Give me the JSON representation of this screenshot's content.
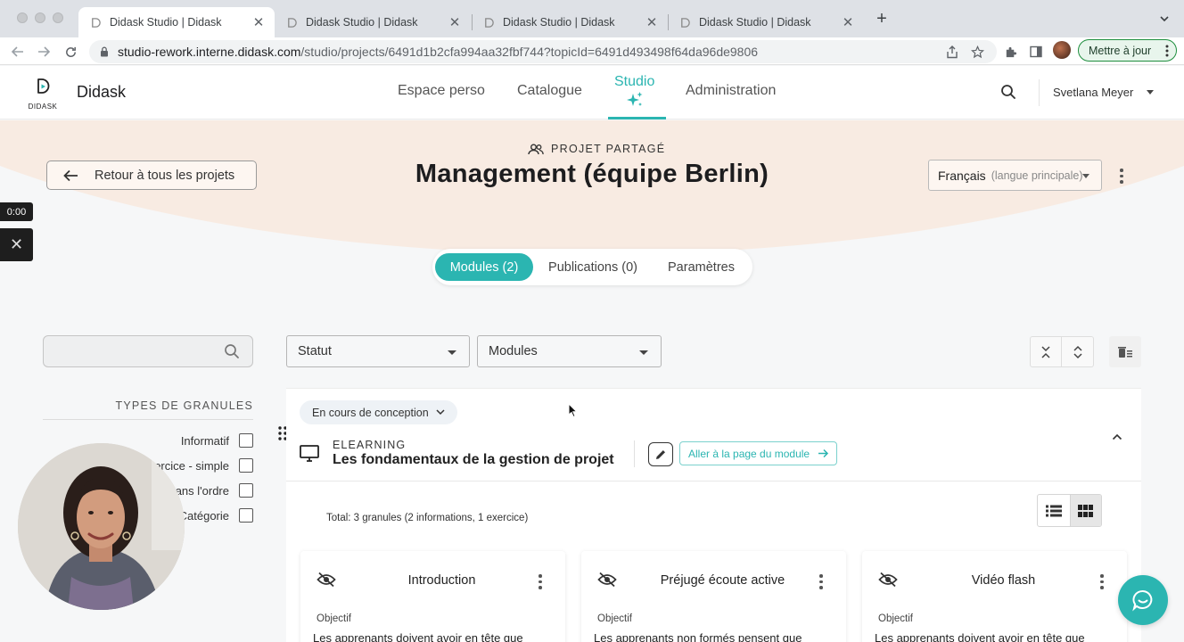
{
  "browser": {
    "tabs": [
      {
        "title": "Didask Studio | Didask",
        "active": true
      },
      {
        "title": "Didask Studio | Didask",
        "active": false
      },
      {
        "title": "Didask Studio | Didask",
        "active": false
      },
      {
        "title": "Didask Studio | Didask",
        "active": false
      }
    ],
    "url_host": "studio-rework.interne.didask.com",
    "url_path": "/studio/projects/6491d1b2cfa994aa32fbf744?topicId=6491d493498f64da96de9806",
    "update_label": "Mettre à jour"
  },
  "header": {
    "logo_text": "DIDASK",
    "brand": "Didask",
    "nav": [
      {
        "label": "Espace perso"
      },
      {
        "label": "Catalogue"
      },
      {
        "label": "Studio"
      },
      {
        "label": "Administration"
      }
    ],
    "user": "Svetlana Meyer"
  },
  "hero": {
    "back_label": "Retour à tous les projets",
    "shared_label": "PROJET PARTAGÉ",
    "title": "Management (équipe Berlin)",
    "language": "Français",
    "language_note": "(langue principale)"
  },
  "recording": {
    "time": "0:00"
  },
  "tabs": [
    {
      "label": "Modules (2)",
      "active": true
    },
    {
      "label": "Publications (0)",
      "active": false
    },
    {
      "label": "Paramètres",
      "active": false
    }
  ],
  "filters": {
    "search_placeholder": "",
    "granule_types_title": "TYPES DE GRANULES",
    "granule_types": [
      {
        "label": "Informatif"
      },
      {
        "label": "Exercice - simple"
      },
      {
        "label": "Dans l'ordre"
      },
      {
        "label": "Catégorie"
      }
    ],
    "status_label": "Statut",
    "modules_label": "Modules"
  },
  "module": {
    "status": "En cours de conception",
    "type": "ELEARNING",
    "name": "Les fondamentaux de la gestion de projet",
    "goto_label": "Aller à la page du module",
    "total": "Total: 3 granules (2 informations, 1 exercice)"
  },
  "granules": [
    {
      "title": "Introduction",
      "objective_label": "Objectif",
      "text": "Les apprenants doivent avoir en tête que"
    },
    {
      "title": "Préjugé écoute active",
      "objective_label": "Objectif",
      "text": "Les apprenants non formés pensent que"
    },
    {
      "title": "Vidéo flash",
      "objective_label": "Objectif",
      "text": "Les apprenants doivent avoir en tête que"
    }
  ],
  "colors": {
    "accent": "#2bb5b1",
    "hero_bg": "#f8ebe2",
    "update_green": "#1e8e3e"
  }
}
